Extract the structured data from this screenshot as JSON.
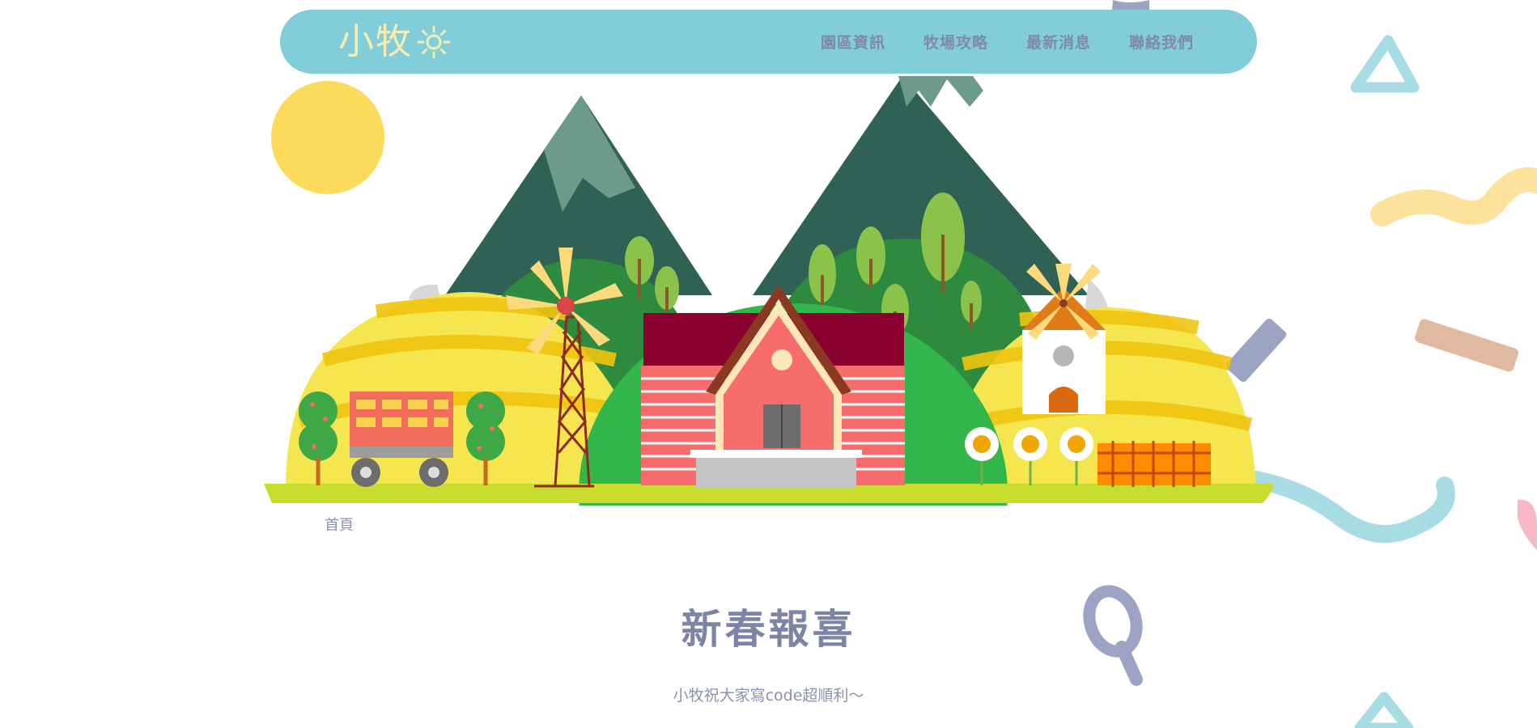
{
  "colors": {
    "navbar_bg": "#81cdd9",
    "logo_text": "#f6ecb0",
    "nav_text": "#7f8aa6",
    "heading": "#7c85a3",
    "body_text": "#8a93ab",
    "sun": "#fcdb5c"
  },
  "brand": {
    "logo_text": "小牧",
    "logo_icon": "sun-icon"
  },
  "nav": {
    "items": [
      {
        "label": "園區資訊"
      },
      {
        "label": "牧場攻略"
      },
      {
        "label": "最新消息"
      },
      {
        "label": "聯絡我們"
      }
    ]
  },
  "hero": {
    "illustration": "farm-landscape-illustration"
  },
  "breadcrumb": {
    "home": "首頁"
  },
  "news": {
    "title": "新春報喜",
    "subtitle": "小牧祝大家寫code超順利～"
  }
}
